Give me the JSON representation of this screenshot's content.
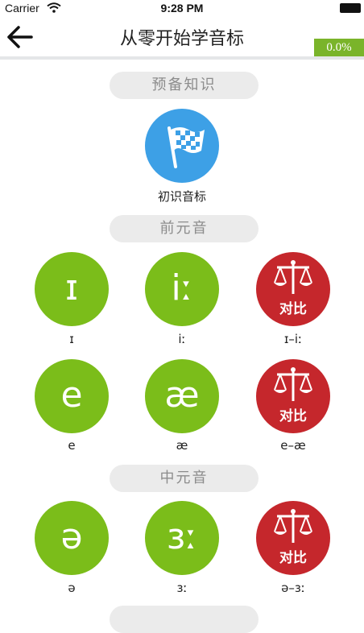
{
  "status": {
    "carrier": "Carrier",
    "time": "9:28 PM"
  },
  "nav": {
    "title": "从零开始学音标",
    "progress": "0.0%"
  },
  "sections": [
    {
      "label": "预备知识"
    },
    {
      "label": "前元音"
    },
    {
      "label": "中元音"
    }
  ],
  "intro": {
    "label": "初识音标"
  },
  "front_vowels": [
    {
      "symbol": "ɪ",
      "caption": "ɪ"
    },
    {
      "symbol": "iː",
      "caption": "iː"
    },
    {
      "compare": "对比",
      "caption": "ɪ–iː"
    },
    {
      "symbol": "e",
      "caption": "e"
    },
    {
      "symbol": "æ",
      "caption": "æ"
    },
    {
      "compare": "对比",
      "caption": "e–æ"
    }
  ],
  "central_vowels": [
    {
      "symbol": "ə",
      "caption": "ə"
    },
    {
      "symbol": "ɜː",
      "caption": "ɜː"
    },
    {
      "compare": "对比",
      "caption": "ə–ɜː"
    }
  ],
  "colors": {
    "green": "#7bbd1a",
    "red": "#c5272c",
    "blue": "#3da0e6",
    "pill": "#ebebeb"
  },
  "icons": [
    "wifi-icon",
    "battery-icon",
    "back-arrow-icon",
    "checkered-flag-icon",
    "scale-icon"
  ]
}
